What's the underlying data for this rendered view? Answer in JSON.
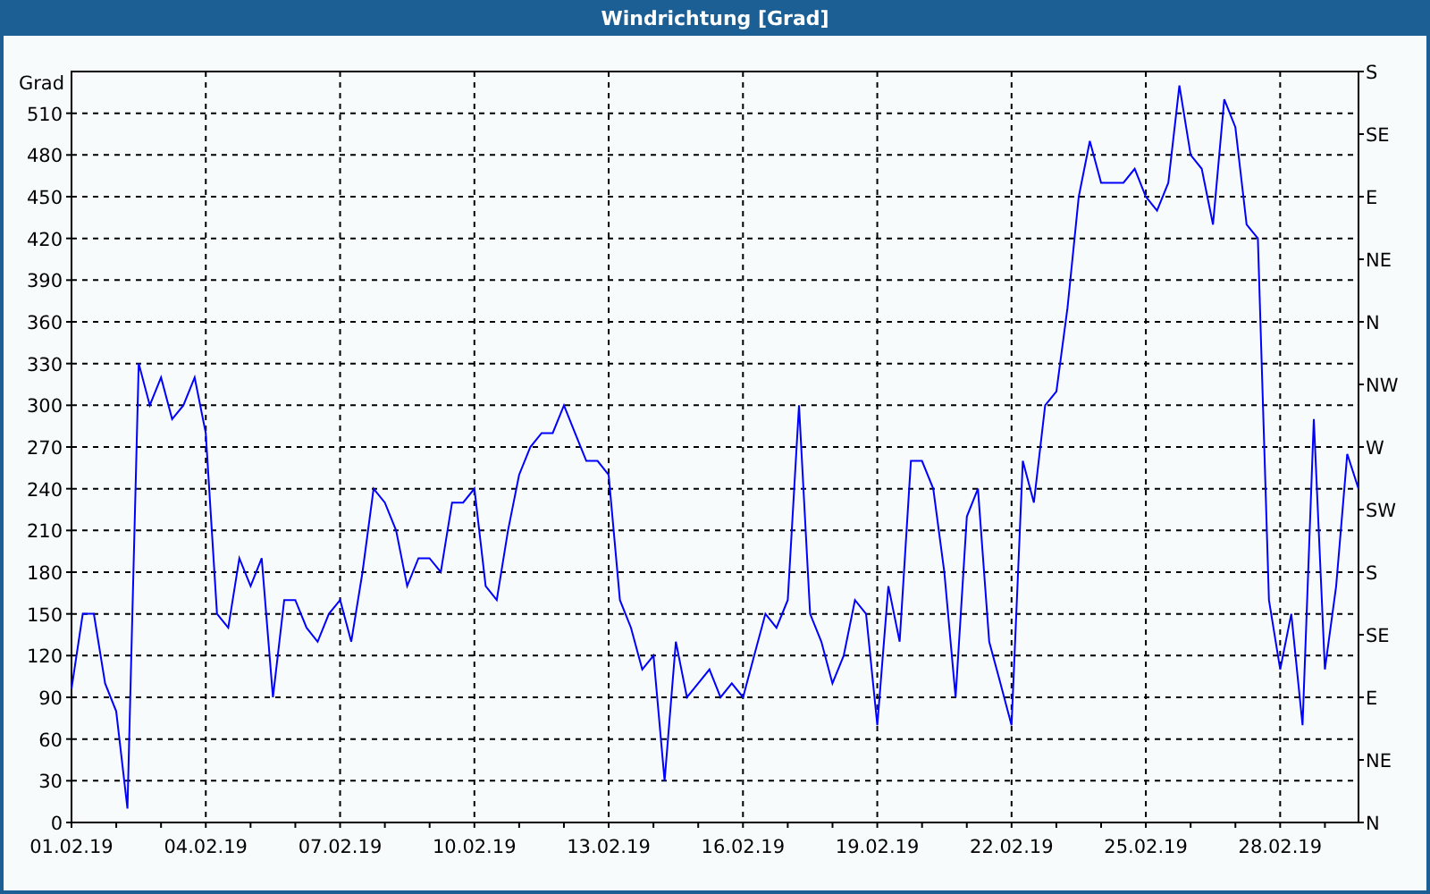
{
  "window": {
    "title": "Windrichtung [Grad]"
  },
  "chart": {
    "right_axis_labels": [
      "S",
      "SE",
      "E",
      "NE",
      "N",
      "NW",
      "W",
      "SW",
      "S",
      "SE",
      "E",
      "NE",
      "N"
    ],
    "chart_data": {
      "type": "line",
      "grid": true,
      "ylabel": "Grad",
      "ylim": [
        0,
        540
      ],
      "yticks": [
        0,
        30,
        60,
        90,
        120,
        150,
        180,
        210,
        240,
        270,
        300,
        330,
        360,
        390,
        420,
        450,
        480,
        510
      ],
      "categories": [
        "01.02.19",
        null,
        null,
        null,
        null,
        null,
        null,
        null,
        null,
        null,
        null,
        null,
        "04.02.19",
        null,
        null,
        null,
        null,
        null,
        null,
        null,
        null,
        null,
        null,
        null,
        "07.02.19",
        null,
        null,
        null,
        null,
        null,
        null,
        null,
        null,
        null,
        null,
        null,
        "10.02.19",
        null,
        null,
        null,
        null,
        null,
        null,
        null,
        null,
        null,
        null,
        null,
        "13.02.19",
        null,
        null,
        null,
        null,
        null,
        null,
        null,
        null,
        null,
        null,
        null,
        "16.02.19",
        null,
        null,
        null,
        null,
        null,
        null,
        null,
        null,
        null,
        null,
        null,
        "19.02.19",
        null,
        null,
        null,
        null,
        null,
        null,
        null,
        null,
        null,
        null,
        null,
        "22.02.19",
        null,
        null,
        null,
        null,
        null,
        null,
        null,
        null,
        null,
        null,
        null,
        "25.02.19",
        null,
        null,
        null,
        null,
        null,
        null,
        null,
        null,
        null,
        null,
        null,
        "28.02.19",
        null,
        null,
        null,
        null,
        null,
        null,
        null
      ],
      "series": [
        {
          "color": "#0000ff",
          "values": [
            96,
            150,
            150,
            100,
            80,
            10,
            330,
            300,
            320,
            290,
            300,
            320,
            280,
            150,
            140,
            190,
            170,
            190,
            90,
            160,
            160,
            140,
            130,
            150,
            160,
            130,
            180,
            240,
            230,
            210,
            170,
            190,
            190,
            180,
            230,
            230,
            240,
            170,
            160,
            210,
            250,
            270,
            280,
            280,
            300,
            280,
            260,
            260,
            250,
            160,
            140,
            110,
            120,
            30,
            130,
            90,
            100,
            110,
            90,
            100,
            90,
            120,
            150,
            140,
            160,
            300,
            150,
            130,
            100,
            120,
            160,
            150,
            70,
            170,
            130,
            260,
            260,
            240,
            180,
            90,
            220,
            240,
            130,
            100,
            70,
            260,
            230,
            300,
            310,
            370,
            450,
            490,
            460,
            460,
            460,
            470,
            450,
            440,
            460,
            530,
            480,
            470,
            430,
            520,
            500,
            430,
            420,
            160,
            110,
            150,
            70,
            290,
            110,
            170,
            265,
            240
          ]
        }
      ]
    }
  }
}
